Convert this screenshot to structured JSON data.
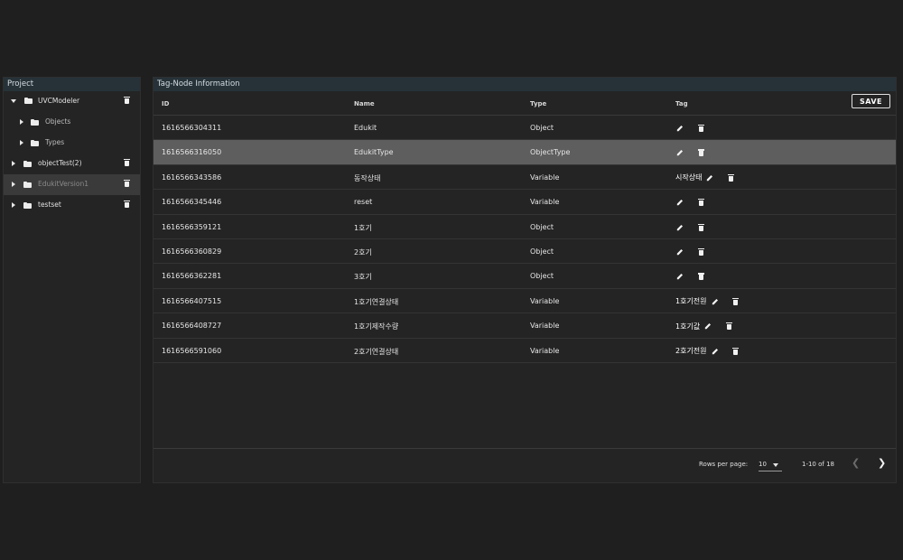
{
  "project": {
    "header": "Project",
    "items": [
      {
        "label": "UVCModeler",
        "expanded": true
      },
      {
        "label": "Objects"
      },
      {
        "label": "Types"
      },
      {
        "label": "objectTest(2)"
      },
      {
        "label": "EdukitVersion1"
      },
      {
        "label": "testset"
      }
    ]
  },
  "tag_panel": {
    "header": "Tag-Node Information",
    "columns": {
      "id": "ID",
      "name": "Name",
      "type": "Type",
      "tag": "Tag"
    },
    "save_label": "SAVE",
    "rows": [
      {
        "id": "1616566304311",
        "name": "Edukit",
        "type": "Object",
        "tag": ""
      },
      {
        "id": "1616566316050",
        "name": "EdukitType",
        "type": "ObjectType",
        "tag": ""
      },
      {
        "id": "1616566343586",
        "name": "동작상태",
        "type": "Variable",
        "tag": "시작상태"
      },
      {
        "id": "1616566345446",
        "name": "reset",
        "type": "Variable",
        "tag": ""
      },
      {
        "id": "1616566359121",
        "name": "1호기",
        "type": "Object",
        "tag": ""
      },
      {
        "id": "1616566360829",
        "name": "2호기",
        "type": "Object",
        "tag": ""
      },
      {
        "id": "1616566362281",
        "name": "3호기",
        "type": "Object",
        "tag": ""
      },
      {
        "id": "1616566407515",
        "name": "1호기연결상태",
        "type": "Variable",
        "tag": "1호기전원"
      },
      {
        "id": "1616566408727",
        "name": "1호기제작수량",
        "type": "Variable",
        "tag": "1호기값"
      },
      {
        "id": "1616566591060",
        "name": "2호기연결상태",
        "type": "Variable",
        "tag": "2호기전원"
      }
    ],
    "pagination": {
      "rows_per_page_label": "Rows per page:",
      "rows_per_page": "10",
      "range": "1-10 of 18"
    }
  },
  "icons": {
    "edit": "pencil-icon",
    "delete": "trash-icon",
    "folder": "folder-icon",
    "expand": "caret-icon",
    "prev": "chevron-left-icon",
    "next": "chevron-right-icon"
  },
  "colors": {
    "background": "#1f1f1f",
    "panel": "#242424",
    "header": "#263238",
    "selected_row": "#5e5e5e"
  }
}
